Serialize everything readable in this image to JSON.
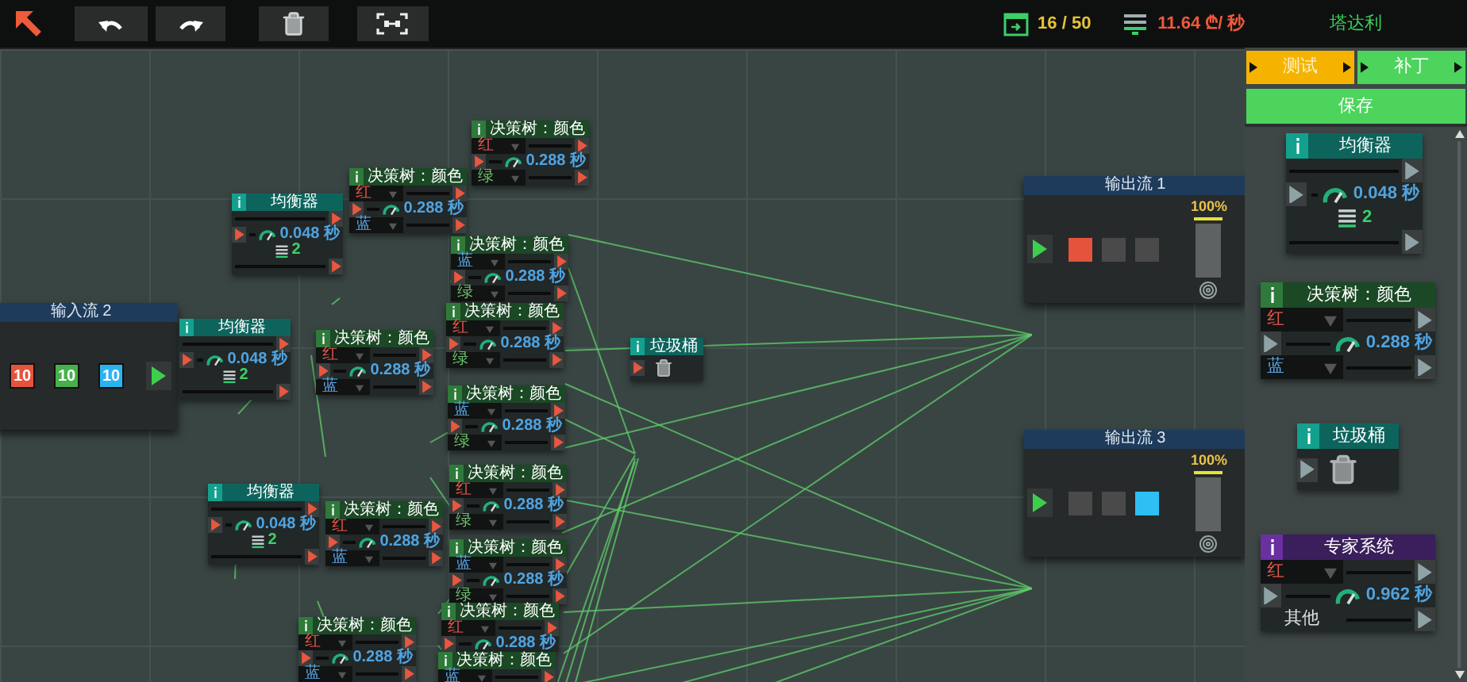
{
  "toolbar": {
    "capacity": "16 / 50",
    "income": "11.64 ₾/ 秒",
    "player": "塔达利"
  },
  "canvas": {
    "input_stream": {
      "title": "输入流 2",
      "items": [
        {
          "value": "10",
          "color": "#e5533d"
        },
        {
          "value": "10",
          "color": "#47b04b"
        },
        {
          "value": "10",
          "color": "#2bb3f0"
        }
      ]
    },
    "nodes": [
      {
        "kind": "decision",
        "title": "决策树：颜色",
        "options": [
          {
            "label": "红",
            "color": "#e5574a"
          },
          {
            "label": "绿",
            "color": "#6cc46c"
          }
        ],
        "speed": "0.288 秒"
      },
      {
        "kind": "decision",
        "title": "决策树：颜色",
        "options": [
          {
            "label": "红",
            "color": "#e5574a"
          },
          {
            "label": "蓝",
            "color": "#5aa8e8"
          }
        ],
        "speed": "0.288 秒"
      },
      {
        "kind": "balancer",
        "title": "均衡器",
        "speed": "0.048 秒",
        "count": "2"
      },
      {
        "kind": "decision",
        "title": "决策树：颜色",
        "options": [
          {
            "label": "蓝",
            "color": "#5aa8e8"
          },
          {
            "label": "绿",
            "color": "#6cc46c"
          }
        ],
        "speed": "0.288 秒"
      },
      {
        "kind": "decision",
        "title": "决策树：颜色",
        "options": [
          {
            "label": "红",
            "color": "#e5574a"
          },
          {
            "label": "绿",
            "color": "#6cc46c"
          }
        ],
        "speed": "0.288 秒"
      },
      {
        "kind": "balancer",
        "title": "均衡器",
        "speed": "0.048 秒",
        "count": "2"
      },
      {
        "kind": "decision",
        "title": "决策树：颜色",
        "options": [
          {
            "label": "红",
            "color": "#e5574a"
          },
          {
            "label": "蓝",
            "color": "#5aa8e8"
          }
        ],
        "speed": "0.288 秒"
      },
      {
        "kind": "trash",
        "title": "垃圾桶"
      },
      {
        "kind": "decision",
        "title": "决策树：颜色",
        "options": [
          {
            "label": "蓝",
            "color": "#5aa8e8"
          },
          {
            "label": "绿",
            "color": "#6cc46c"
          }
        ],
        "speed": "0.288 秒"
      },
      {
        "kind": "decision",
        "title": "决策树：颜色",
        "options": [
          {
            "label": "红",
            "color": "#e5574a"
          },
          {
            "label": "绿",
            "color": "#6cc46c"
          }
        ],
        "speed": "0.288 秒"
      },
      {
        "kind": "balancer",
        "title": "均衡器",
        "speed": "0.048 秒",
        "count": "2"
      },
      {
        "kind": "decision",
        "title": "决策树：颜色",
        "options": [
          {
            "label": "红",
            "color": "#e5574a"
          },
          {
            "label": "蓝",
            "color": "#5aa8e8"
          }
        ],
        "speed": "0.288 秒"
      },
      {
        "kind": "decision",
        "title": "决策树：颜色",
        "options": [
          {
            "label": "蓝",
            "color": "#5aa8e8"
          },
          {
            "label": "绿",
            "color": "#6cc46c"
          }
        ],
        "speed": "0.288 秒"
      },
      {
        "kind": "decision",
        "title": "决策树：颜色",
        "options": [
          {
            "label": "红",
            "color": "#e5574a"
          }
        ],
        "speed": "0.288 秒"
      },
      {
        "kind": "decision",
        "title": "决策树：颜色",
        "options": [
          {
            "label": "红",
            "color": "#e5574a"
          },
          {
            "label": "蓝",
            "color": "#5aa8e8"
          }
        ],
        "speed": "0.288 秒"
      },
      {
        "kind": "decision",
        "title": "决策树：颜色",
        "options": [
          {
            "label": "蓝",
            "color": "#5aa8e8"
          }
        ]
      }
    ],
    "outputs": [
      {
        "title": "输出流 1",
        "percent": "100%",
        "level": 1,
        "slots": [
          {
            "color": "#e5533d"
          },
          {
            "color": "#4a4a4a"
          },
          {
            "color": "#4a4a4a"
          }
        ]
      },
      {
        "title": "输出流 3",
        "percent": "100%",
        "level": 1,
        "slots": [
          {
            "color": "#4a4a4a"
          },
          {
            "color": "#4a4a4a"
          },
          {
            "color": "#2ec0f5"
          }
        ]
      }
    ]
  },
  "side_panel": {
    "tabs": [
      {
        "label": "测试",
        "selected": true
      },
      {
        "label": "补丁",
        "selected": false
      }
    ],
    "save": "保存",
    "palette": [
      {
        "kind": "balancer",
        "title": "均衡器",
        "speed": "0.048 秒",
        "count": "2"
      },
      {
        "kind": "decision",
        "title": "决策树：颜色",
        "options": [
          {
            "label": "红",
            "color": "#e5574a"
          },
          {
            "label": "蓝",
            "color": "#5aa8e8"
          }
        ],
        "speed": "0.288 秒"
      },
      {
        "kind": "trash",
        "title": "垃圾桶"
      },
      {
        "kind": "expert",
        "title": "专家系统",
        "options": [
          {
            "label": "红",
            "color": "#e5574a"
          }
        ],
        "speed": "0.962 秒",
        "fallback": "其他"
      }
    ]
  }
}
